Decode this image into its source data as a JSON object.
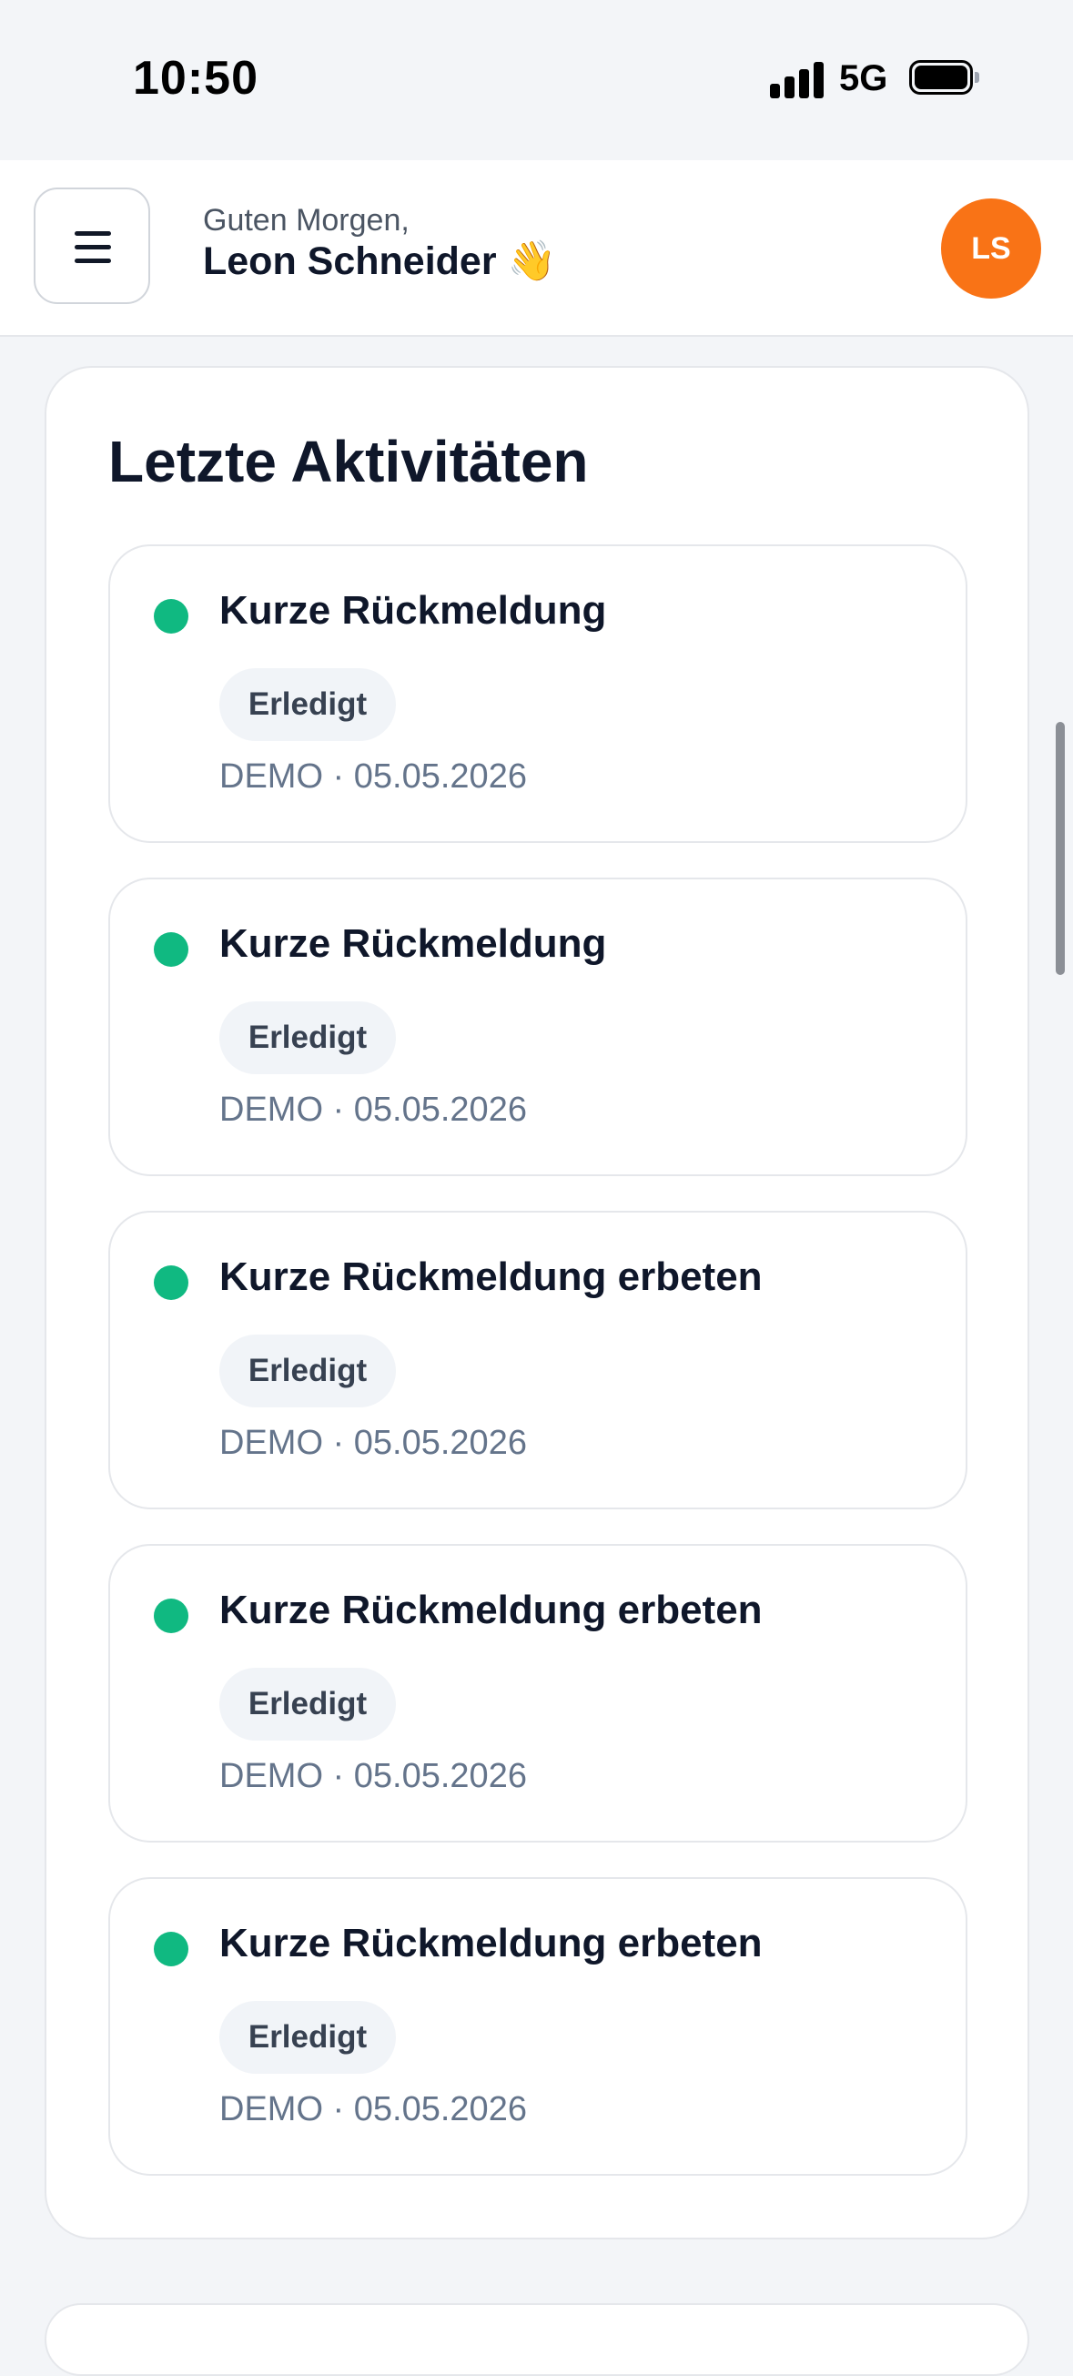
{
  "status_bar": {
    "time": "10:50",
    "network": "5G"
  },
  "header": {
    "greeting": "Guten Morgen,",
    "user_name": "Leon Schneider 👋",
    "avatar_initials": "LS",
    "avatar_color": "#f97316"
  },
  "activities": {
    "title": "Letzte Aktivitäten",
    "items": [
      {
        "title": "Kurze Rückmeldung",
        "status": "Erledigt",
        "meta": "DEMO · 05.05.2026"
      },
      {
        "title": "Kurze Rückmeldung",
        "status": "Erledigt",
        "meta": "DEMO · 05.05.2026"
      },
      {
        "title": "Kurze Rückmeldung erbeten",
        "status": "Erledigt",
        "meta": "DEMO · 05.05.2026"
      },
      {
        "title": "Kurze Rückmeldung erbeten",
        "status": "Erledigt",
        "meta": "DEMO · 05.05.2026"
      },
      {
        "title": "Kurze Rückmeldung erbeten",
        "status": "Erledigt",
        "meta": "DEMO · 05.05.2026"
      }
    ]
  },
  "colors": {
    "status_dot": "#10b981",
    "accent": "#f97316"
  }
}
